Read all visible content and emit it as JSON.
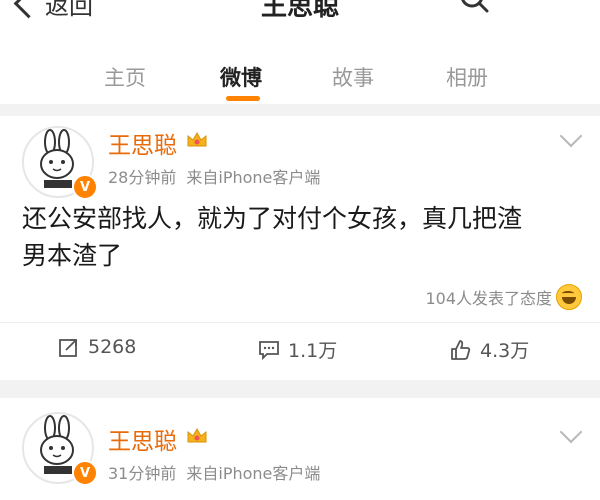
{
  "nav": {
    "back_label": "返回",
    "title": "王思聪"
  },
  "tabs": [
    {
      "label": "主页",
      "active": false
    },
    {
      "label": "微博",
      "active": true
    },
    {
      "label": "故事",
      "active": false
    },
    {
      "label": "相册",
      "active": false
    }
  ],
  "colors": {
    "accent": "#ff8200",
    "author_name": "#e86b0a",
    "muted_text": "#8c8c8c",
    "section_gap": "#f2f2f2"
  },
  "posts": [
    {
      "author": "王思聪",
      "avatar_icon": "cartoon-rabbit-avatar",
      "badge_icon": "verified-v-badge",
      "time": "28分钟前",
      "source": "来自iPhone客户端",
      "content_line1": "还公安部找人，就为了对付个女孩，真几把渣",
      "content_line2": "男本渣了",
      "reactions_text": "104人发表了态度",
      "reposts": "5268",
      "comments": "1.1万",
      "likes": "4.3万"
    },
    {
      "author": "王思聪",
      "avatar_icon": "cartoon-rabbit-avatar",
      "badge_icon": "verified-v-badge",
      "time": "31分钟前",
      "source": "来自iPhone客户端"
    }
  ]
}
